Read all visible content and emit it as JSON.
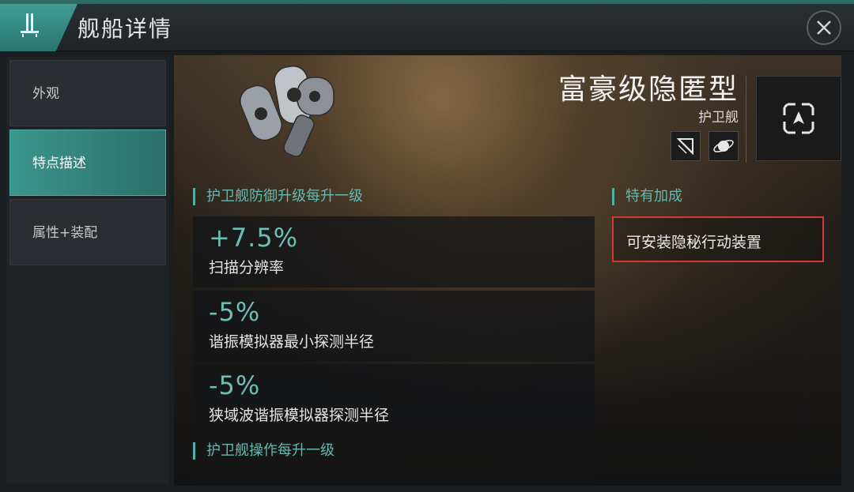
{
  "header": {
    "title": "舰船详情",
    "logo_icon": "fleet-emblem-icon",
    "close_icon": "close-icon"
  },
  "sidebar": {
    "items": [
      {
        "label": "外观",
        "active": false
      },
      {
        "label": "特点描述",
        "active": true
      },
      {
        "label": "属性+装配",
        "active": false
      }
    ]
  },
  "ship": {
    "name": "富豪级隐匿型",
    "class": "护卫舰",
    "icons": [
      "ship-type-icon",
      "planet-icon",
      "target-frame-icon"
    ]
  },
  "bonuses": {
    "section1": {
      "title": "护卫舰防御升级每升一级",
      "items": [
        {
          "value": "+7.5%",
          "desc": "扫描分辨率"
        },
        {
          "value": "-5%",
          "desc": "谐振模拟器最小探测半径"
        },
        {
          "value": "-5%",
          "desc": "狭域波谐振模拟器探测半径"
        }
      ]
    },
    "section2": {
      "title": "护卫舰操作每升一级"
    }
  },
  "special": {
    "title": "特有加成",
    "items": [
      "可安装隐秘行动装置"
    ]
  },
  "colors": {
    "accent": "#4fb0a6",
    "value_text": "#6cbfb5",
    "highlight_border": "#d23a3a"
  }
}
